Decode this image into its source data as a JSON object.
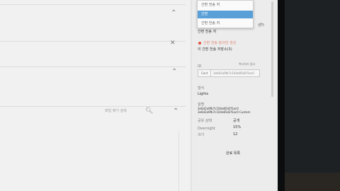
{
  "dropdown": {
    "options": [
      {
        "label": "간편 전송 저"
      },
      {
        "label": "간편"
      },
      {
        "label": "간편 전송 저"
      }
    ],
    "selected_index": 1
  },
  "main": {
    "search": {
      "placeholder": "파일 찾기 검색",
      "icon": "search-icon"
    },
    "controls": {
      "collapse_1": "⌃",
      "close": "✕",
      "collapse_2": "⌃",
      "collapse_3": "⌃"
    }
  },
  "side": {
    "mode_label": "간편 전송 저",
    "arrow": "∨",
    "link_right": "링크",
    "warning": "간편 전송 링크만 생성",
    "warning_sub": "이 간편 전송 저장소(3)",
    "id_label": "ID",
    "id_link": "복사하기 링크",
    "id_tag": "Cont",
    "id_value": "3e6d2a9fb7c104e85d2f1ac0",
    "type_label": "형식",
    "type_value": "Lights",
    "desc_label": "설명",
    "desc_value": "3e6d2a9fb7c104e85d2f1ac0 3e6d2a9fb7c104e85d2f1ac0 Custom",
    "rows": [
      {
        "key": "공유 상태",
        "val": "공개"
      },
      {
        "key": "Overnight",
        "val": "15%"
      },
      {
        "key": "크기",
        "val": "12"
      }
    ],
    "footer": "완료 목록"
  }
}
